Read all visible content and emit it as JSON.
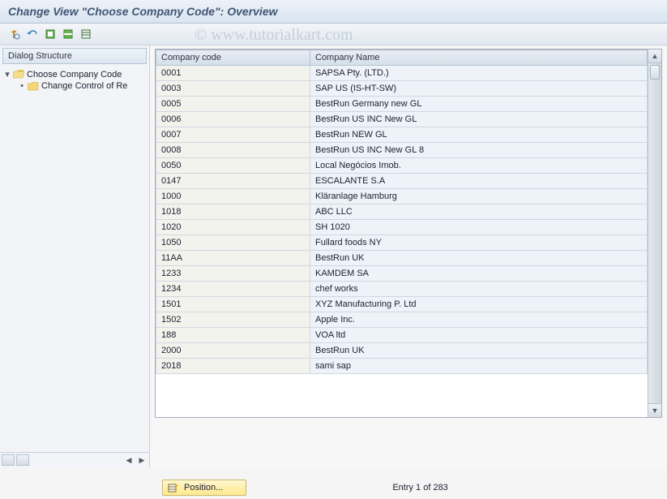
{
  "title": "Change View \"Choose Company Code\": Overview",
  "watermark": "© www.tutorialkart.com",
  "dialog": {
    "header": "Dialog Structure",
    "items": [
      {
        "label": "Choose Company Code",
        "open": true
      },
      {
        "label": "Change Control of Re",
        "open": false
      }
    ]
  },
  "table": {
    "headers": {
      "code": "Company code",
      "name": "Company Name"
    },
    "rows": [
      {
        "code": "0001",
        "name": "SAPSA Pty. (LTD.)"
      },
      {
        "code": "0003",
        "name": "SAP US (IS-HT-SW)"
      },
      {
        "code": "0005",
        "name": "BestRun Germany new GL"
      },
      {
        "code": "0006",
        "name": "BestRun US INC New GL"
      },
      {
        "code": "0007",
        "name": "BestRun NEW GL"
      },
      {
        "code": "0008",
        "name": "BestRun US INC New GL 8"
      },
      {
        "code": "0050",
        "name": "Local Negócios Imob."
      },
      {
        "code": "0147",
        "name": "ESCALANTE S.A"
      },
      {
        "code": "1000",
        "name": "Kläranlage Hamburg"
      },
      {
        "code": "1018",
        "name": "ABC LLC"
      },
      {
        "code": "1020",
        "name": "SH 1020"
      },
      {
        "code": "1050",
        "name": "Fullard foods NY"
      },
      {
        "code": "11AA",
        "name": "BestRun UK"
      },
      {
        "code": "1233",
        "name": "KAMDEM SA"
      },
      {
        "code": "1234",
        "name": "chef works"
      },
      {
        "code": "1501",
        "name": "XYZ Manufacturing P. Ltd"
      },
      {
        "code": "1502",
        "name": "Apple Inc."
      },
      {
        "code": "188",
        "name": "VOA ltd"
      },
      {
        "code": "2000",
        "name": "BestRun UK"
      },
      {
        "code": "2018",
        "name": "sami sap"
      }
    ]
  },
  "footer": {
    "position_label": "Position...",
    "entry_status": "Entry 1 of 283"
  }
}
